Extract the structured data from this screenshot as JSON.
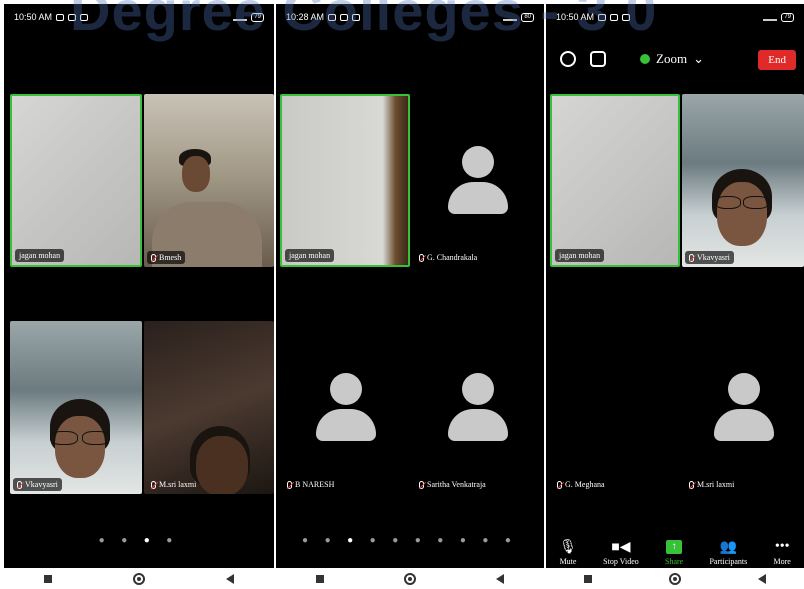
{
  "watermark": "Degree Colleges - 3 0",
  "phones": [
    {
      "time": "10:50 AM",
      "battery": "79",
      "tiles": [
        {
          "name": "jagan mohan"
        },
        {
          "name": "Bmesh"
        },
        {
          "name": "Vkavyasri"
        },
        {
          "name": "M.sri laxmi"
        }
      ],
      "dots": "● ● ● ●",
      "active_page": 3
    },
    {
      "time": "10:28 AM",
      "battery": "80",
      "tiles": [
        {
          "name": "jagan mohan"
        },
        {
          "name": "G. Chandrakala"
        },
        {
          "name": "B NARESH"
        },
        {
          "name": "Saritha Venkatraja"
        }
      ],
      "dots": "● ● ● ● ● ● ● ● ● ●",
      "active_page": 3
    },
    {
      "time": "10:50 AM",
      "battery": "79",
      "meeting_title": "Zoom",
      "end_label": "End",
      "tiles": [
        {
          "name": "jagan mohan"
        },
        {
          "name": "Vkavyasri"
        },
        {
          "name": "G. Meghana"
        },
        {
          "name": "M.sri laxmi"
        }
      ],
      "toolbar": [
        {
          "label": "Mute",
          "icon": "microphone-icon"
        },
        {
          "label": "Stop Video",
          "icon": "video-camera-icon"
        },
        {
          "label": "Share",
          "icon": "share-arrow-icon"
        },
        {
          "label": "Participants",
          "icon": "participants-icon"
        },
        {
          "label": "More",
          "icon": "more-dots-icon"
        }
      ]
    }
  ],
  "colors": {
    "active_border": "#38c038",
    "end_button": "#e02a2a",
    "background": "#000000"
  }
}
